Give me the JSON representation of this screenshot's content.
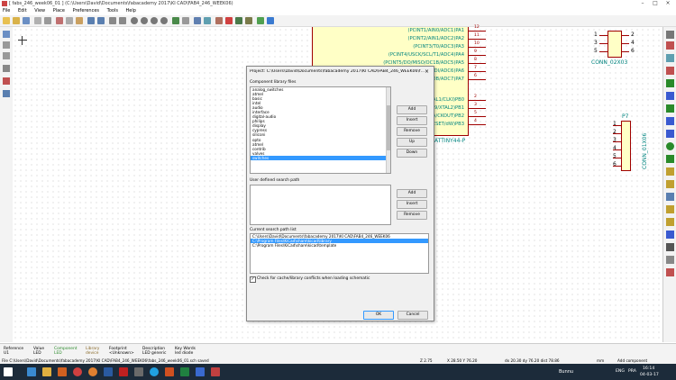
{
  "window": {
    "title": "[ fabs_246_week06_01 ] (C:\\Users\\David\\Documents\\fabacademy 2017\\KI CAD\\FAB4_246_WEEK06)",
    "minimize": "–",
    "maximize": "□",
    "close": "×"
  },
  "menu": [
    "File",
    "Edit",
    "View",
    "Place",
    "Preferences",
    "Tools",
    "Help"
  ],
  "chip": {
    "pins_upper": [
      {
        "label": "(PCINT1/AIN0/ADC1)PA1",
        "num": "12"
      },
      {
        "label": "(PCINT2/AIN1/ADC2)PA2",
        "num": "11"
      },
      {
        "label": "(PCINT3/T0/ADC3)PA3",
        "num": "10"
      },
      {
        "label": "(PCINT4/USCK/SCL/T1/ADC4)PA4",
        "num": "9"
      },
      {
        "label": "(PCINT5/DO/MISO/OC1B/ADC5)PA5",
        "num": "8"
      },
      {
        "label": "(PCINT6/OC1A/SDA/MOSI/DI/ADC6)PA6",
        "num": "7"
      },
      {
        "label": "(PCINT7/ICP/OC0B/ADC7)PA7",
        "num": "6"
      }
    ],
    "pins_lower": [
      {
        "label": "(PCINT8/XTAL1/CLKI)PB0",
        "num": "2"
      },
      {
        "label": "(PCINT9/XTAL2)PB1",
        "num": "3"
      },
      {
        "label": "(PCINT10/INT0/OC0A/CKOUT)PB2",
        "num": "5"
      },
      {
        "label": "(PCINT11/RESET/dW)PB3",
        "num": "4"
      }
    ],
    "name": "ATTINY44-P"
  },
  "conn1": {
    "pins_left": [
      "1",
      "3",
      "5"
    ],
    "pins_right": [
      "2",
      "4",
      "6"
    ],
    "name": "CONN_02X03"
  },
  "conn2": {
    "ref": "P7",
    "pins": [
      "1",
      "2",
      "3",
      "4",
      "5",
      "6"
    ],
    "name": "CONN_01X06"
  },
  "dialog": {
    "title": "Project: C:\\Users\\David\\Documents\\fabacademy 2017\\KI CAD\\FAB4_246_WEEK06\\fabs_246_week06_01.pro",
    "library_label": "Component library files",
    "libraries": [
      "analog_switches",
      "atmel",
      "basic",
      "intel",
      "audio",
      "interface",
      "digital-audio",
      "philips",
      "display",
      "cypress",
      "siliconi",
      "opto",
      "atmel",
      "contrib",
      "valves",
      "switches"
    ],
    "selected_library_index": 15,
    "lib_buttons": [
      "Add",
      "Insert",
      "Remove",
      "Up",
      "Down"
    ],
    "user_path_label": "User defined search path",
    "path_buttons": [
      "Add",
      "Insert",
      "Remove"
    ],
    "current_path_label": "Current search path list",
    "current_paths": [
      "C:\\Users\\David\\Documents\\fabacademy 2017\\KI CAD\\FAB4_246_WEEK06",
      "C:\\Program Files\\KiCad\\share\\kicad\\library",
      "C:\\Program Files\\KiCad\\share\\kicad\\template"
    ],
    "selected_path_index": 1,
    "checkbox_label": "Check for cache/library conflicts when loading schematic",
    "checkbox_checked": true,
    "ok": "OK",
    "cancel": "Cancel"
  },
  "statusbar": {
    "fields": [
      {
        "top": "Reference",
        "bottom": "U1"
      },
      {
        "top": "Value",
        "bottom": "LED"
      },
      {
        "top": "Component",
        "bottom": "LED"
      },
      {
        "top": "Library",
        "bottom": "device"
      },
      {
        "top": "Footprint",
        "bottom": "<Unknown>"
      },
      {
        "top": "Description",
        "bottom": "LED generic"
      },
      {
        "top": "Key Words",
        "bottom": "led diode"
      }
    ],
    "path": "File C:\\Users\\David\\Documents\\fabacademy 2017\\KI CAD\\FAB4_246_WEEK06\\fabs_246_week06_01.sch saved",
    "zoom": "Z 2.75",
    "coords": "X 28.50  Y 76.20",
    "delta": "dx 20.30  dy 76.20  dist 78.86",
    "units": "mm",
    "mode": "Add component"
  },
  "taskbar": {
    "weather": "Bunnu",
    "lang": "ENG",
    "region": "PRA",
    "time": "16:14",
    "date": "04-03-17"
  }
}
